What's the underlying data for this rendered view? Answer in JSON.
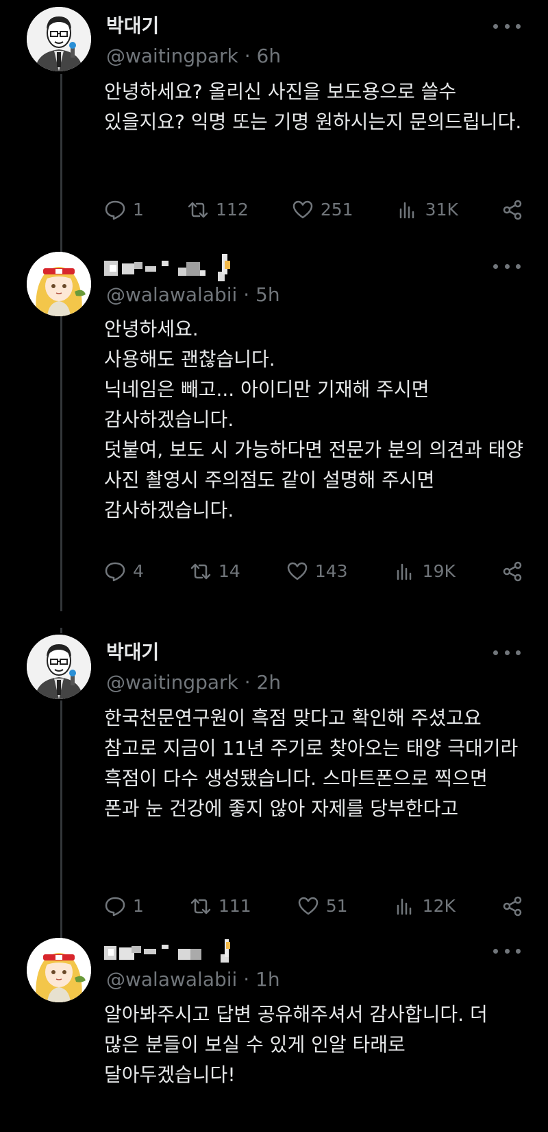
{
  "tweets": [
    {
      "author_name": "박대기",
      "handle": "@waitingpark",
      "time": "6h",
      "separator": "·",
      "paragraphs": [
        "안녕하세요? 올리신 사진을 보도용으로 쓸수 있을지요? 익명 또는 기명 원하시는지 문의드립니다."
      ],
      "replies": "1",
      "retweets": "112",
      "likes": "251",
      "views": "31K"
    },
    {
      "author_name": "",
      "handle": "@walawalabii",
      "time": "5h",
      "separator": "·",
      "paragraphs": [
        "안녕하세요.",
        "사용해도 괜찮습니다.",
        "닉네임은 빼고... 아이디만 기재해 주시면 감사하겠습니다.",
        "덧붙여, 보도 시 가능하다면 전문가 분의 의견과 태양 사진 촬영시 주의점도 같이 설명해 주시면 감사하겠습니다."
      ],
      "replies": "4",
      "retweets": "14",
      "likes": "143",
      "views": "19K"
    },
    {
      "author_name": "박대기",
      "handle": "@waitingpark",
      "time": "2h",
      "separator": "·",
      "paragraphs": [
        "한국천문연구원이 흑점 맞다고 확인해 주셨고요 참고로 지금이 11년 주기로 찾아오는 태양 극대기라 흑점이 다수 생성됐습니다. 스마트폰으로 찍으면 폰과 눈 건강에 좋지 않아 자제를 당부한다고"
      ],
      "replies": "1",
      "retweets": "111",
      "likes": "51",
      "views": "12K"
    },
    {
      "author_name": "",
      "handle": "@walawalabii",
      "time": "1h",
      "separator": "·",
      "paragraphs": [
        "알아봐주시고 답변 공유해주셔서 감사합니다. 더 많은 분들이 보실 수 있게 인알 타래로 달아두겠습니다!"
      ]
    }
  ],
  "colors": {
    "background": "#000000",
    "text": "#e7e9ea",
    "muted": "#71767b",
    "thread_line": "#333639"
  }
}
